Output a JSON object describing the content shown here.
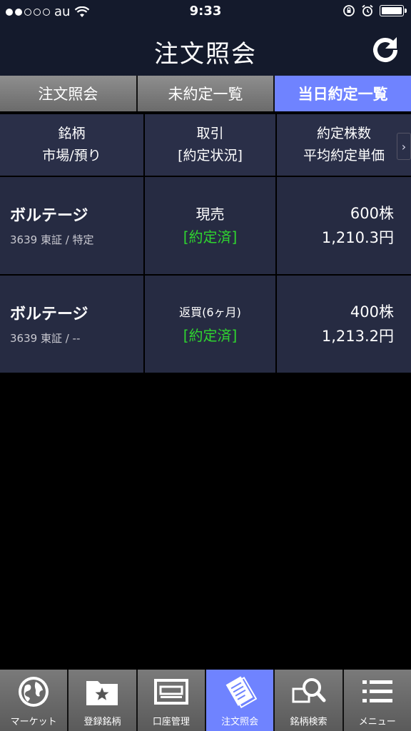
{
  "status_bar": {
    "carrier": "au",
    "time": "9:33"
  },
  "header": {
    "title": "注文照会"
  },
  "tabs": [
    {
      "label": "注文照会"
    },
    {
      "label": "未約定一覧"
    },
    {
      "label": "当日約定一覧"
    }
  ],
  "table": {
    "headers": {
      "col1_line1": "銘柄",
      "col1_line2": "市場/預り",
      "col2_line1": "取引",
      "col2_line2": "[約定状況]",
      "col3_line1": "約定株数",
      "col3_line2": "平均約定単価"
    },
    "rows": [
      {
        "name": "ボルテージ",
        "code_market": "3639 東証 / 特定",
        "trade": "現売",
        "status": "[約定済]",
        "shares": "600株",
        "price": "1,210.3円"
      },
      {
        "name": "ボルテージ",
        "code_market": "3639 東証 / --",
        "trade": "返買(6ヶ月)",
        "status": "[約定済]",
        "shares": "400株",
        "price": "1,213.2円"
      }
    ]
  },
  "tabbar": [
    {
      "label": "マーケット",
      "icon": "globe-icon"
    },
    {
      "label": "登録銘柄",
      "icon": "star-folder-icon"
    },
    {
      "label": "口座管理",
      "icon": "account-icon"
    },
    {
      "label": "注文照会",
      "icon": "document-icon"
    },
    {
      "label": "銘柄検索",
      "icon": "search-icon"
    },
    {
      "label": "メニュー",
      "icon": "menu-icon"
    }
  ],
  "colors": {
    "accent": "#6f83ff",
    "status_green": "#2fd62f",
    "cell_bg": "#262b42",
    "header_bg": "#141a2c"
  }
}
